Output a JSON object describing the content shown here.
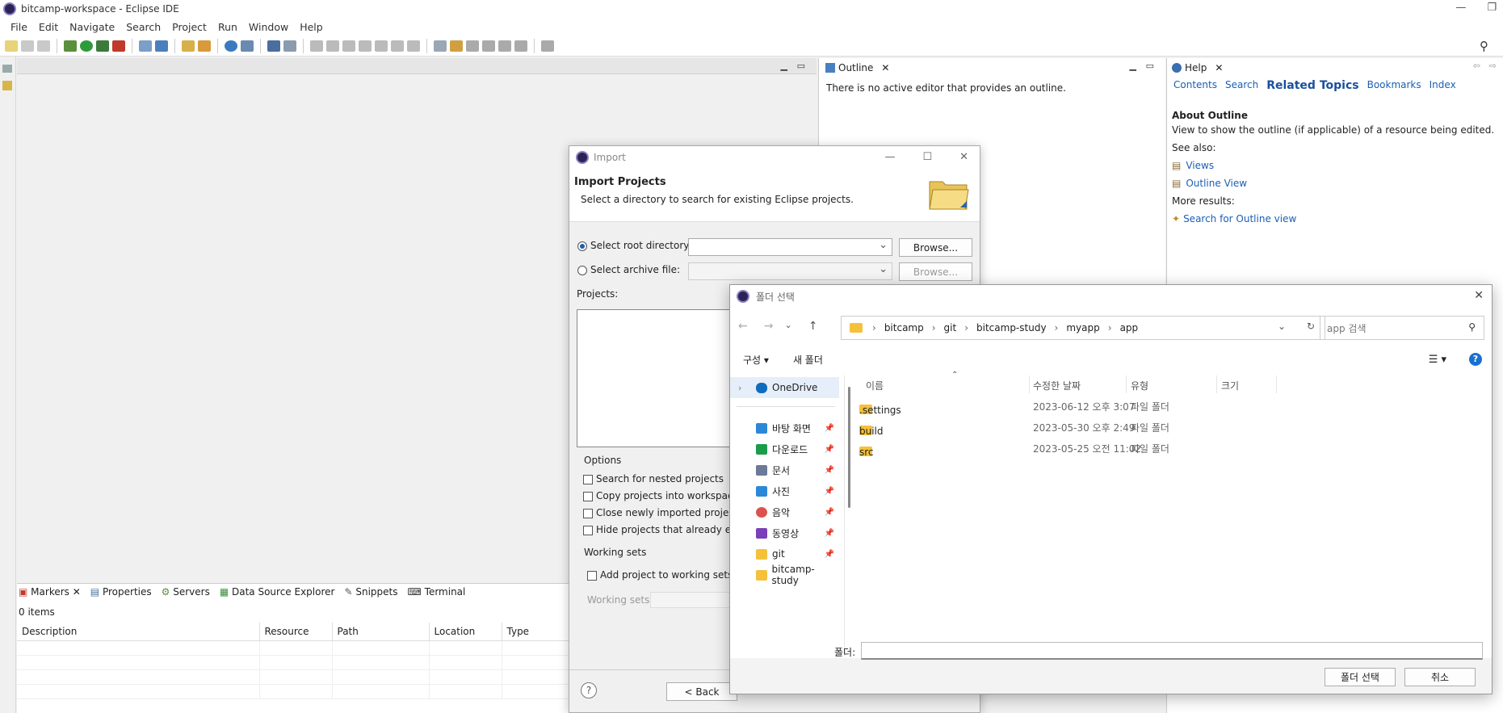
{
  "window": {
    "title": "bitcamp-workspace - Eclipse IDE"
  },
  "menu": [
    "File",
    "Edit",
    "Navigate",
    "Search",
    "Project",
    "Run",
    "Window",
    "Help"
  ],
  "outline": {
    "tab_label": "Outline",
    "message": "There is no active editor that provides an outline."
  },
  "help": {
    "tab_label": "Help",
    "links": {
      "contents": "Contents",
      "search": "Search",
      "related": "Related Topics",
      "bookmarks": "Bookmarks",
      "index": "Index"
    },
    "about_title": "About Outline",
    "about_desc": "View to show the outline (if applicable) of a resource being edited.",
    "see_also": "See also:",
    "see_links": [
      "Views",
      "Outline View"
    ],
    "more_results": "More results:",
    "more_link": "Search for Outline view"
  },
  "bottom": {
    "tabs": [
      "Markers",
      "Properties",
      "Servers",
      "Data Source Explorer",
      "Snippets",
      "Terminal"
    ],
    "count": "0 items",
    "columns": [
      "Description",
      "Resource",
      "Path",
      "Location",
      "Type"
    ]
  },
  "import_dialog": {
    "title": "Import",
    "heading": "Import Projects",
    "description": "Select a directory to search for existing Eclipse projects.",
    "root_dir_label": "Select root directory:",
    "archive_label": "Select archive file:",
    "browse": "Browse...",
    "projects_label": "Projects:",
    "options_label": "Options",
    "options": [
      "Search for nested projects",
      "Copy projects into workspace",
      "Close newly imported projects",
      "Hide projects that already exist"
    ],
    "working_sets_label": "Working sets",
    "add_working_sets": "Add project to working sets",
    "working_sets_field": "Working sets:",
    "back_button": "< Back"
  },
  "folder_dialog": {
    "title": "폴더 선택",
    "path": [
      "bitcamp",
      "git",
      "bitcamp-study",
      "myapp",
      "app"
    ],
    "search_placeholder": "app 검색",
    "organize": "구성",
    "new_folder": "새 폴더",
    "sidebar": [
      {
        "label": "OneDrive",
        "icon": "cloud-icon",
        "color": "#0f6cbd",
        "pinned": false
      },
      {
        "label": "바탕 화면",
        "icon": "desktop-icon",
        "color": "#2b88d8",
        "pinned": true
      },
      {
        "label": "다운로드",
        "icon": "download-icon",
        "color": "#1a9c4a",
        "pinned": true
      },
      {
        "label": "문서",
        "icon": "document-icon",
        "color": "#6b7a99",
        "pinned": true
      },
      {
        "label": "사진",
        "icon": "picture-icon",
        "color": "#2b88d8",
        "pinned": true
      },
      {
        "label": "음악",
        "icon": "music-icon",
        "color": "#d9534f",
        "pinned": true
      },
      {
        "label": "동영상",
        "icon": "video-icon",
        "color": "#7b3fb8",
        "pinned": true
      },
      {
        "label": "git",
        "icon": "folder-icon",
        "color": "#f5c13b",
        "pinned": true
      },
      {
        "label": "bitcamp-study",
        "icon": "folder-icon",
        "color": "#f5c13b",
        "pinned": false
      }
    ],
    "columns": [
      "이름",
      "수정한 날짜",
      "유형",
      "크기"
    ],
    "files": [
      {
        "name": ".settings",
        "modified": "2023-06-12 오후 3:07",
        "type": "파일 폴더"
      },
      {
        "name": "build",
        "modified": "2023-05-30 오후 2:49",
        "type": "파일 폴더"
      },
      {
        "name": "src",
        "modified": "2023-05-25 오전 11:02",
        "type": "파일 폴더"
      }
    ],
    "folder_label": "폴더:",
    "select_button": "폴더 선택",
    "cancel_button": "취소"
  }
}
